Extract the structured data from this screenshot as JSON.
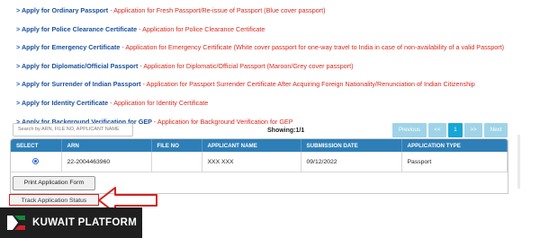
{
  "services": [
    {
      "title": "Apply for Ordinary Passport",
      "desc": "Application for Fresh Passport/Re-issue of Passport (Blue cover passport)"
    },
    {
      "title": "Apply for Police Clearance Certificate",
      "desc": "Application for Police Clearance Certificate"
    },
    {
      "title": "Apply for Emergency Certificate",
      "desc": "Application for Emergency Certificate (White cover passport for one-way travel to India in case of non-availability of a valid Passport)"
    },
    {
      "title": "Apply for Diplomatic/Official Passport",
      "desc": "Application for Diplomatic/Official Passport (Maroon/Grey cover passport)"
    },
    {
      "title": "Apply for Surrender of Indian Passport",
      "desc": "Application for Passport Surrender Certificate After Acquiring Foreign Nationality/Renunciation of Indian Citizenship"
    },
    {
      "title": "Apply for Identity Certificate",
      "desc": "Application for Identity Certificate"
    },
    {
      "title": "Apply for Background Verification for GEP",
      "desc": "Application for Background Verification for GEP"
    }
  ],
  "search": {
    "placeholder": "Search by ARN, FILE NO, APPLICANT NAME"
  },
  "showing": "Showing:1/1",
  "pager": {
    "previous": "Previous",
    "first": "<<",
    "page": "1",
    "last": ">>",
    "next": "Next"
  },
  "table": {
    "headers": [
      "SELECT",
      "ARN",
      "FILE NO",
      "APPLICANT NAME",
      "SUBMISSION DATE",
      "APPLICATION TYPE"
    ],
    "row": {
      "arn": "22-2004463960",
      "file_no": "",
      "applicant_name": "XXX XXX",
      "submission_date": "09/12/2022",
      "application_type": "Passport"
    }
  },
  "buttons": {
    "print": "Print Application Form",
    "track": "Track Application Status"
  },
  "brand": {
    "name": "KUWAIT PLATFORM"
  },
  "colors": {
    "header_blue": "#2e7fb8",
    "link_blue": "#1a4f9c",
    "desc_red": "#d42a20",
    "pager_active": "#16a6d6",
    "highlight_red": "#d62020"
  }
}
